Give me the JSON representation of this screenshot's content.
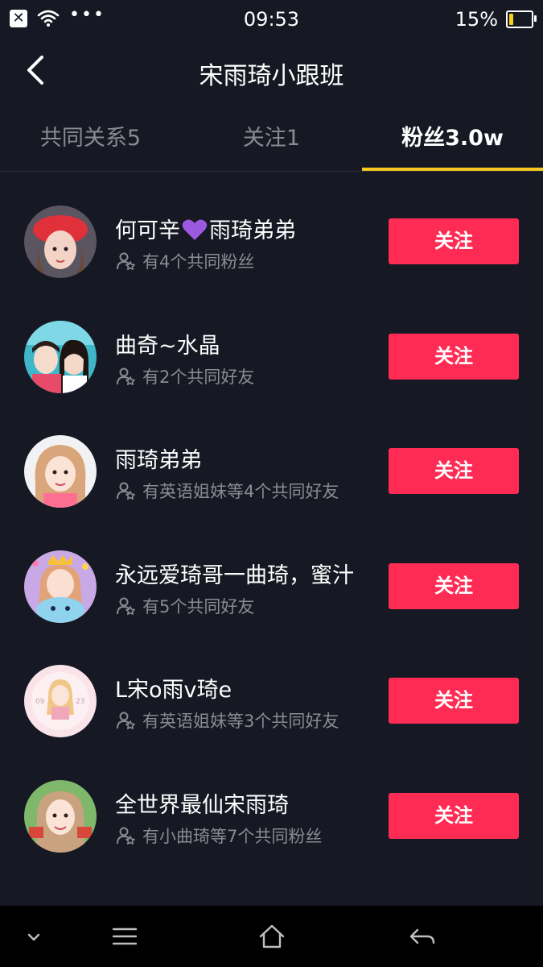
{
  "status_bar": {
    "time": "09:53",
    "battery": "15%",
    "battery_level": 0.15,
    "left_icons": [
      "close-notification-icon",
      "wifi-icon",
      "more-dots-icon"
    ]
  },
  "header": {
    "title": "宋雨琦小跟班",
    "back_icon": "chevron-left-icon"
  },
  "tabs": [
    {
      "label": "共同关系5",
      "active": false
    },
    {
      "label": "关注1",
      "active": false
    },
    {
      "label": "粉丝3.0w",
      "active": true
    }
  ],
  "colors": {
    "background": "#161823",
    "accent_red": "#fe2c55",
    "tab_indicator": "#f7c71f",
    "muted_text": "#8a8b91"
  },
  "users": [
    {
      "name": "何可辛",
      "emoji": "purple-heart",
      "name_suffix": "雨琦弟弟",
      "mutual": "有4个共同粉丝",
      "button": "关注"
    },
    {
      "name": "曲奇~水晶",
      "mutual": "有2个共同好友",
      "button": "关注"
    },
    {
      "name": "雨琦弟弟",
      "mutual": "有英语姐妹等4个共同好友",
      "button": "关注"
    },
    {
      "name": "永远爱琦哥一曲琦，蜜汁",
      "mutual": "有5个共同好友",
      "button": "关注"
    },
    {
      "name": "L宋o雨v琦e",
      "mutual": "有英语姐妹等3个共同好友",
      "button": "关注"
    },
    {
      "name": "全世界最仙宋雨琦",
      "mutual": "有小曲琦等7个共同粉丝",
      "button": "关注"
    }
  ],
  "nav_bar": {
    "icons": [
      "collapse-icon",
      "menu-icon",
      "home-icon",
      "back-icon"
    ]
  }
}
